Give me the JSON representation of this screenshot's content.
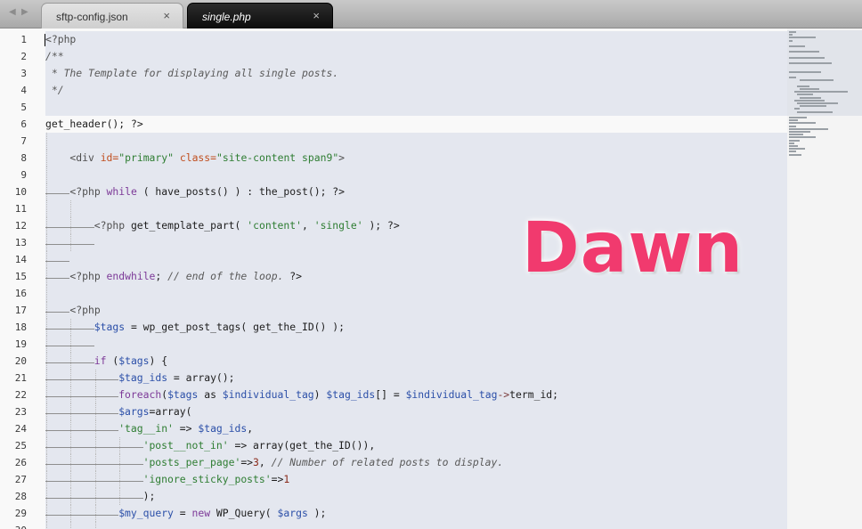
{
  "tabs": {
    "nav_left": "◀",
    "nav_right": "▶",
    "inactive": {
      "label": "sftp-config.json",
      "close": "×"
    },
    "active": {
      "label": "single.php",
      "close": "×"
    }
  },
  "theme_watermark": "Dawn",
  "colors": {
    "tab_active_bg": "#111111",
    "line_highlight": "#e4e7ef",
    "watermark": "#f13a6e",
    "string": "#2e7d32",
    "keyword": "#7d3a98",
    "variable": "#2b4fa8"
  },
  "editor": {
    "lines": [
      {
        "n": "1",
        "tokens": [
          [
            "tag",
            "<?php"
          ]
        ]
      },
      {
        "n": "2",
        "tokens": [
          [
            "comment",
            "/**"
          ]
        ]
      },
      {
        "n": "3",
        "tokens": [
          [
            "comment",
            " * The Template for displaying all single posts."
          ]
        ]
      },
      {
        "n": "4",
        "tokens": [
          [
            "comment",
            " */"
          ]
        ]
      },
      {
        "n": "5",
        "tokens": []
      },
      {
        "n": "6",
        "tokens": [
          [
            "fn",
            "get_header(); ?>"
          ]
        ]
      },
      {
        "n": "7",
        "tokens": []
      },
      {
        "n": "8",
        "tokens": [
          [
            "tag",
            "<div "
          ],
          [
            "attr",
            "id="
          ],
          [
            "string",
            "\"primary\""
          ],
          [
            "tag",
            " "
          ],
          [
            "attr",
            "class="
          ],
          [
            "string",
            "\"site-content span9\""
          ],
          [
            "tag",
            ">"
          ]
        ]
      },
      {
        "n": "9",
        "tokens": []
      },
      {
        "n": "10",
        "tokens": [
          [
            "tag",
            "<?php "
          ],
          [
            "keyword",
            "while"
          ],
          [
            "fn",
            " ( have_posts() ) : the_post(); ?>"
          ]
        ]
      },
      {
        "n": "11",
        "tokens": []
      },
      {
        "n": "12",
        "tokens": [
          [
            "tag",
            "<?php "
          ],
          [
            "fn",
            "get_template_part( "
          ],
          [
            "string",
            "'content'"
          ],
          [
            "fn",
            ", "
          ],
          [
            "string",
            "'single'"
          ],
          [
            "fn",
            " ); ?>"
          ]
        ]
      },
      {
        "n": "13",
        "tokens": []
      },
      {
        "n": "14",
        "tokens": []
      },
      {
        "n": "15",
        "tokens": [
          [
            "tag",
            "<?php "
          ],
          [
            "keyword",
            "endwhile"
          ],
          [
            "fn",
            "; "
          ],
          [
            "comment",
            "// end of the loop."
          ],
          [
            "fn",
            " ?>"
          ]
        ]
      },
      {
        "n": "16",
        "tokens": []
      },
      {
        "n": "17",
        "tokens": [
          [
            "tag",
            "<?php"
          ]
        ]
      },
      {
        "n": "18",
        "tokens": [
          [
            "var",
            "$tags"
          ],
          [
            "fn",
            " = wp_get_post_tags( get_the_ID() );"
          ]
        ]
      },
      {
        "n": "19",
        "tokens": []
      },
      {
        "n": "20",
        "tokens": [
          [
            "keyword",
            "if"
          ],
          [
            "fn",
            " ("
          ],
          [
            "var",
            "$tags"
          ],
          [
            "fn",
            ") {"
          ]
        ]
      },
      {
        "n": "21",
        "tokens": [
          [
            "var",
            "$tag_ids"
          ],
          [
            "fn",
            " = array();"
          ]
        ]
      },
      {
        "n": "22",
        "tokens": [
          [
            "keyword",
            "foreach"
          ],
          [
            "fn",
            "("
          ],
          [
            "var",
            "$tags"
          ],
          [
            "fn",
            " as "
          ],
          [
            "var",
            "$individual_tag"
          ],
          [
            "fn",
            ") "
          ],
          [
            "var",
            "$tag_ids"
          ],
          [
            "fn",
            "[] = "
          ],
          [
            "var",
            "$individual_tag"
          ],
          [
            "op",
            "->"
          ],
          [
            "fn",
            "term_id;"
          ]
        ]
      },
      {
        "n": "23",
        "tokens": [
          [
            "var",
            "$args"
          ],
          [
            "fn",
            "=array("
          ]
        ]
      },
      {
        "n": "24",
        "tokens": [
          [
            "string",
            "'tag__in'"
          ],
          [
            "fn",
            " => "
          ],
          [
            "var",
            "$tag_ids"
          ],
          [
            "fn",
            ","
          ]
        ]
      },
      {
        "n": "25",
        "tokens": [
          [
            "string",
            "'post__not_in'"
          ],
          [
            "fn",
            " => array(get_the_ID()),"
          ]
        ]
      },
      {
        "n": "26",
        "tokens": [
          [
            "string",
            "'posts_per_page'"
          ],
          [
            "fn",
            "=>"
          ],
          [
            "num",
            "3"
          ],
          [
            "fn",
            ", "
          ],
          [
            "comment",
            "// Number of related posts to display."
          ]
        ]
      },
      {
        "n": "27",
        "tokens": [
          [
            "string",
            "'ignore_sticky_posts'"
          ],
          [
            "fn",
            "=>"
          ],
          [
            "num",
            "1"
          ]
        ]
      },
      {
        "n": "28",
        "tokens": [
          [
            "fn",
            ");"
          ]
        ]
      },
      {
        "n": "29",
        "tokens": [
          [
            "var",
            "$my_query"
          ],
          [
            "fn",
            " = "
          ],
          [
            "keyword",
            "new"
          ],
          [
            "fn",
            " WP_Query( "
          ],
          [
            "var",
            "$args"
          ],
          [
            "fn",
            " );"
          ]
        ]
      },
      {
        "n": "30",
        "tokens": []
      }
    ]
  }
}
